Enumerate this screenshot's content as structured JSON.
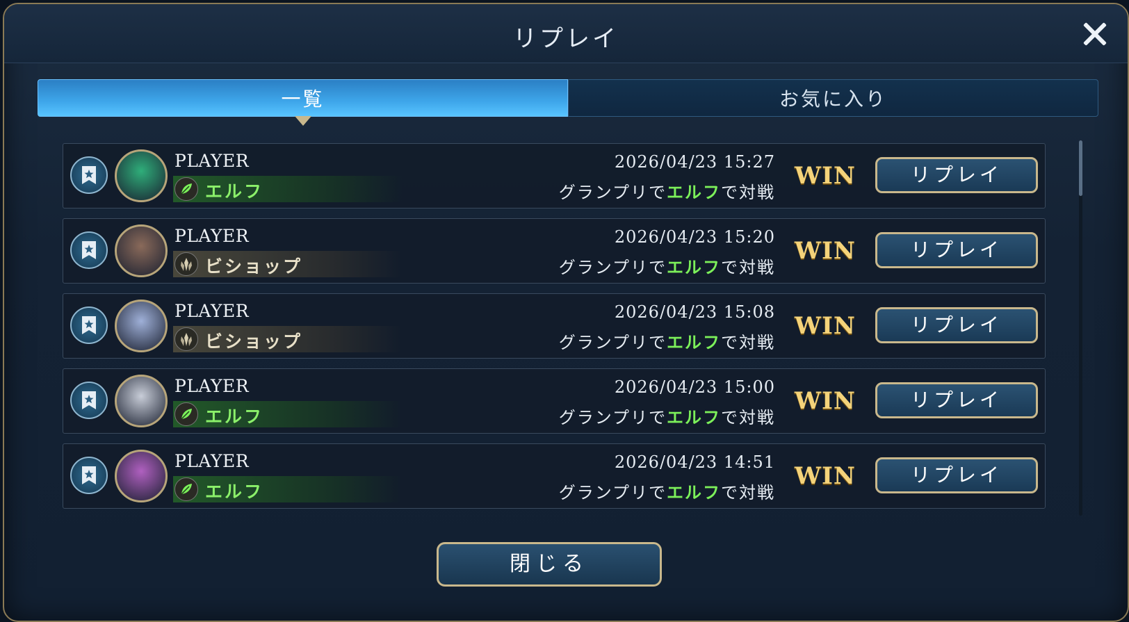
{
  "title": "リプレイ",
  "tabs": [
    {
      "label": "一覧",
      "active": true
    },
    {
      "label": "お気に入り",
      "active": false
    }
  ],
  "rows": [
    {
      "player": "PLAYER",
      "class": "エルフ",
      "class_type": "elf",
      "date": "2026/04/23 15:27",
      "desc_prefix": "グランプリで",
      "desc_class": "エルフ",
      "desc_suffix": "で対戦",
      "result": "WIN",
      "button": "リプレイ",
      "avatar_color": "#2fae7a"
    },
    {
      "player": "PLAYER",
      "class": "ビショップ",
      "class_type": "bishop",
      "date": "2026/04/23 15:20",
      "desc_prefix": "グランプリで",
      "desc_class": "エルフ",
      "desc_suffix": "で対戦",
      "result": "WIN",
      "button": "リプレイ",
      "avatar_color": "#8a6a5a"
    },
    {
      "player": "PLAYER",
      "class": "ビショップ",
      "class_type": "bishop",
      "date": "2026/04/23 15:08",
      "desc_prefix": "グランプリで",
      "desc_class": "エルフ",
      "desc_suffix": "で対戦",
      "result": "WIN",
      "button": "リプレイ",
      "avatar_color": "#9fb0d8"
    },
    {
      "player": "PLAYER",
      "class": "エルフ",
      "class_type": "elf",
      "date": "2026/04/23 15:00",
      "desc_prefix": "グランプリで",
      "desc_class": "エルフ",
      "desc_suffix": "で対戦",
      "result": "WIN",
      "button": "リプレイ",
      "avatar_color": "#c8cdd8"
    },
    {
      "player": "PLAYER",
      "class": "エルフ",
      "class_type": "elf",
      "date": "2026/04/23 14:51",
      "desc_prefix": "グランプリで",
      "desc_class": "エルフ",
      "desc_suffix": "で対戦",
      "result": "WIN",
      "button": "リプレイ",
      "avatar_color": "#b060c0"
    }
  ],
  "close_button": "閉じる",
  "colors": {
    "win": "#f4d37a",
    "elf_green": "#7cf05a",
    "frame_gold": "#c9b88c"
  },
  "icons": {
    "close": "close-icon",
    "favorite": "bookmark-star-icon",
    "elf": "leaf-icon",
    "bishop": "bishop-crest-icon"
  }
}
